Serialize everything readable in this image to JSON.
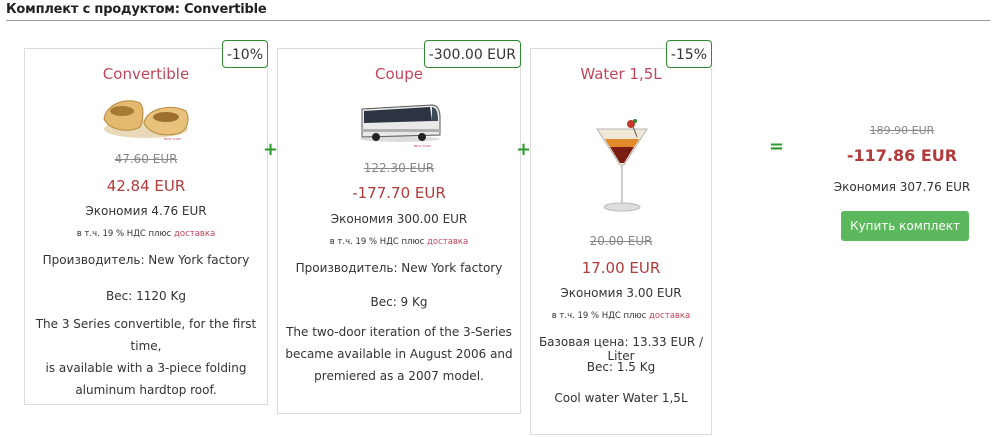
{
  "header": {
    "title": "Комплект с продуктом: Convertible"
  },
  "products": [
    {
      "badge": "-10%",
      "name": "Convertible",
      "image": "wooden-clogs-image",
      "old_price": "47.60 EUR",
      "price": "42.84 EUR",
      "saving": "Экономия 4.76 EUR",
      "vat_prefix": "в т.ч. 19 % НДС плюс",
      "vat_link": "доставка",
      "manufacturer": "Производитель: New York factory",
      "weight": "Вес: 1120 Kg",
      "description": [
        "The 3 Series convertible, for the first time,",
        "is available with a 3-piece folding",
        "aluminum hardtop roof."
      ]
    },
    {
      "badge": "-300.00 EUR",
      "name": "Coupe",
      "image": "bus-image",
      "old_price": "122.30 EUR",
      "price": "-177.70 EUR",
      "saving": "Экономия 300.00 EUR",
      "vat_prefix": "в т.ч. 19 % НДС плюс",
      "vat_link": "доставка",
      "manufacturer": "Производитель: New York factory",
      "weight": "Вес: 9 Kg",
      "description": [
        "The two-door iteration of the 3-Series",
        "became available in August 2006 and",
        "premiered as a 2007 model."
      ]
    },
    {
      "badge": "-15%",
      "name": "Water 1,5L",
      "image": "cocktail-glass-image",
      "old_price": "20.00 EUR",
      "price": "17.00 EUR",
      "saving": "Экономия 3.00 EUR",
      "vat_prefix": "в т.ч. 19 % НДС плюс",
      "vat_link": "доставка",
      "base_price": "Базовая цена: 13.33 EUR / Liter",
      "weight": "Вес: 1.5 Kg",
      "description": [
        "Cool water Water 1,5L"
      ]
    }
  ],
  "operators": {
    "plus": "+",
    "equals": "="
  },
  "total": {
    "old_price": "189.90 EUR",
    "price": "-117.86 EUR",
    "saving": "Экономия 307.76 EUR",
    "buy_label": "Купить комплект"
  },
  "colors": {
    "accent_green": "#5cb85c",
    "price_red": "#b23a3a",
    "title_pink": "#c0465a",
    "badge_border": "#2e8b2e"
  }
}
